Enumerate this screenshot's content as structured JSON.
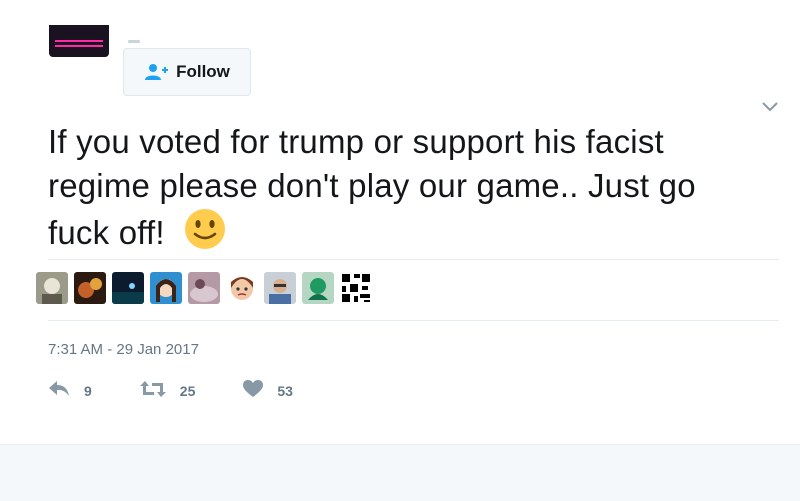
{
  "header": {
    "follow_label": "Follow"
  },
  "tweet": {
    "text_line1": "If you voted for trump or support his facist",
    "text_line2": "regime please don't play our game.. Just go",
    "text_line3": "fuck off!",
    "emoji": "slightly-smiling-face"
  },
  "likers": {
    "avatars": [
      "avatar-1",
      "avatar-2",
      "avatar-3",
      "avatar-4",
      "avatar-5",
      "avatar-6",
      "avatar-7",
      "avatar-8",
      "avatar-9"
    ]
  },
  "meta": {
    "timestamp": "7:31 AM - 29 Jan 2017"
  },
  "actions": {
    "reply_count": "9",
    "retweet_count": "25",
    "like_count": "53"
  },
  "colors": {
    "text": "#14171a",
    "muted": "#657786",
    "divider": "#e6ecf0",
    "emoji_yellow": "#ffcc4d"
  }
}
